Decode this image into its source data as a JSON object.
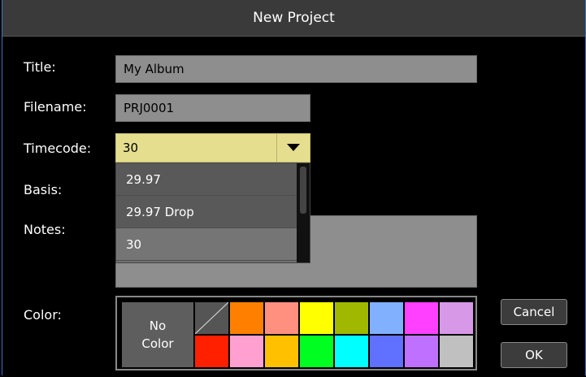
{
  "dialog": {
    "title": "New Project"
  },
  "form": {
    "title_label": "Title:",
    "title_value": "My Album",
    "filename_label": "Filename:",
    "filename_value": "PRJ0001",
    "timecode_label": "Timecode:",
    "timecode_value": "30",
    "basis_label": "Basis:",
    "notes_label": "Notes:",
    "notes_value": "",
    "color_label": "Color:"
  },
  "timecode_options": [
    "29.97",
    "29.97 Drop",
    "30"
  ],
  "timecode_selected": "30",
  "palette": {
    "no_color_line1": "No",
    "no_color_line2": "Color",
    "row1": [
      "none-diagonal",
      "#ff8000",
      "#ff9080",
      "#ffff00",
      "#a0b800",
      "#80b0ff",
      "#ff40ff",
      "#d898e8"
    ],
    "row2": [
      "#ff2000",
      "#ffa0d0",
      "#ffc000",
      "#00ff20",
      "#00ffff",
      "#6070ff",
      "#c070ff",
      "#c0c0c0"
    ]
  },
  "buttons": {
    "cancel": "Cancel",
    "ok": "OK"
  }
}
